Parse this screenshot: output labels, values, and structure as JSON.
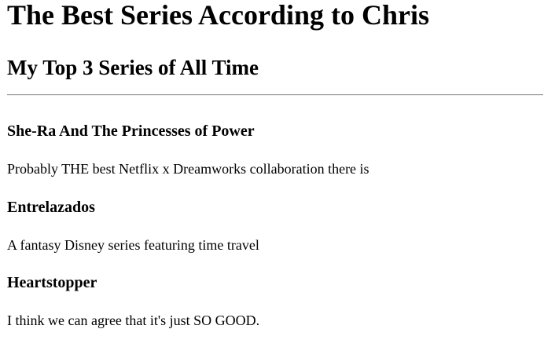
{
  "page": {
    "title": "The Best Series According to Chris",
    "subtitle": "My Top 3 Series of All Time"
  },
  "series": [
    {
      "name": "She-Ra And The Princesses of Power",
      "description": "Probably THE best Netflix x Dreamworks collaboration there is"
    },
    {
      "name": "Entrelazados",
      "description": "A fantasy Disney series featuring time travel"
    },
    {
      "name": "Heartstopper",
      "description": "I think we can agree that it's just SO GOOD."
    }
  ]
}
